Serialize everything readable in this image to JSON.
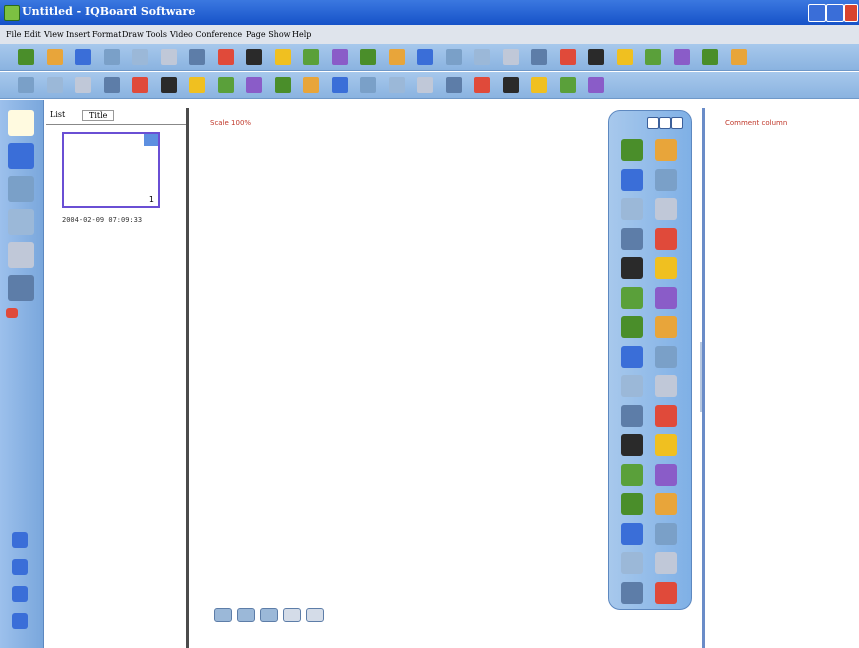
{
  "window": {
    "title": "Untitled - IQBoard Software"
  },
  "menu": [
    "File",
    "Edit",
    "View",
    "Insert",
    "Format",
    "Draw",
    "Tools",
    "Video Conference",
    "Page Show",
    "Help"
  ],
  "toolbar1_icons": [
    "new-file-icon",
    "open-folder-icon",
    "save-icon",
    "print-icon",
    "print-preview-icon",
    "cut-icon",
    "copy-icon",
    "paste-icon",
    "zoom-in-icon",
    "zoom-out-icon",
    "zoom-icon",
    "previous-page-icon",
    "next-page-icon",
    "screen-icon",
    "fit-screen-icon",
    "fullscreen-icon",
    "camera-icon",
    "pen-icon",
    "record-icon",
    "screen-shot-icon",
    "back-icon",
    "black-screen-icon",
    "tools-icon",
    "settings-icon",
    "green-icon",
    "exit-icon"
  ],
  "toolbar2_icons": [
    "select-arrow-icon",
    "mouse-icon",
    "undo-icon",
    "redo-icon",
    "pen-blue-icon",
    "pen-red-icon",
    "pen-thin-icon",
    "highlighter-icon",
    "brush-icon",
    "eraser-icon",
    "line-icon",
    "shape-icon",
    "image-icon",
    "triangle-icon",
    "resource-icon",
    "chart-icon",
    "screen-capture-icon",
    "text-icon",
    "fill-icon",
    "math-tool-icon",
    "signature-icon"
  ],
  "left_rail_icons": [
    "page-list-icon",
    "palette-icon",
    "library-icon",
    "gallery-icon",
    "magnet-icon",
    "chart-gallery-icon",
    "arrow-left-icon"
  ],
  "left_rail_bottom_icons": [
    "expand-icon",
    "person-icon",
    "list-icon",
    "graph-icon"
  ],
  "panel": {
    "tabs": [
      "List",
      "Title"
    ],
    "thumbnail": {
      "number": "1",
      "date": "2004-02-09 07:09:33"
    }
  },
  "canvas": {
    "scale_label": "Scale 100%"
  },
  "comment": {
    "label": "Comment column"
  },
  "float_toolbar_icons": [
    [
      "select-arrow-icon",
      "mouse-icon"
    ],
    [
      "undo-icon",
      "redo-icon"
    ],
    [
      "pen-blue-icon",
      "pen-red-icon"
    ],
    [
      "pen-gray-icon",
      "highlighter-icon"
    ],
    [
      "brush-icon",
      "eraser-icon"
    ],
    [
      "line-icon",
      "shape-icon"
    ],
    [
      "image-icon",
      "triangle-icon"
    ],
    [
      "resource-icon",
      "bar-chart-icon"
    ],
    [
      "screen-capture-icon",
      "text-icon"
    ],
    [
      "fill-icon",
      "math-tool-icon"
    ],
    [
      "spotlight-icon",
      "magic-pen-icon"
    ],
    [
      "record-icon",
      "camera-icon"
    ],
    [
      "black-screen-icon",
      "back-icon"
    ],
    [
      "settings-icon",
      "print-icon"
    ],
    [
      "green-tool-icon",
      "exit-icon"
    ],
    [
      "disk-icon",
      "iq-logo-icon"
    ]
  ],
  "colors": {
    "title_blue": "#1652c8",
    "toolbar_blue": "#8ab3e0",
    "accent_red": "#c0392b"
  }
}
